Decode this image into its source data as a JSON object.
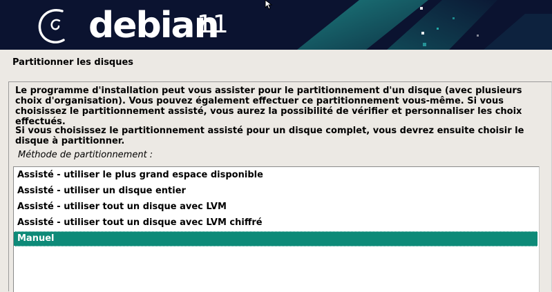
{
  "banner": {
    "brand": "debian",
    "version": "11",
    "colors": {
      "background": "#0b1330",
      "accent": "#2a9d9a",
      "logo": "#ffffff"
    }
  },
  "page": {
    "title": "Partitionner les disques"
  },
  "content": {
    "paragraph1": "Le programme d'installation peut vous assister pour le partitionnement d'un disque (avec plusieurs choix d'organisation). Vous pouvez également effectuer ce partitionnement vous-même. Si vous choisissez le partitionnement assisté, vous aurez la possibilité de vérifier et personnaliser les choix effectués.",
    "paragraph2": "Si vous choisissez le partitionnement assisté pour un disque complet, vous devrez ensuite choisir le disque à partitionner.",
    "method_label": "Méthode de partitionnement :"
  },
  "options": {
    "items": [
      {
        "label": "Assisté - utiliser le plus grand espace disponible"
      },
      {
        "label": "Assisté - utiliser un disque entier"
      },
      {
        "label": "Assisté - utiliser tout un disque avec LVM"
      },
      {
        "label": "Assisté - utiliser tout un disque avec LVM chiffré"
      },
      {
        "label": "Manuel"
      }
    ],
    "selected_index": 4,
    "selected_color": "#0d8a78"
  }
}
